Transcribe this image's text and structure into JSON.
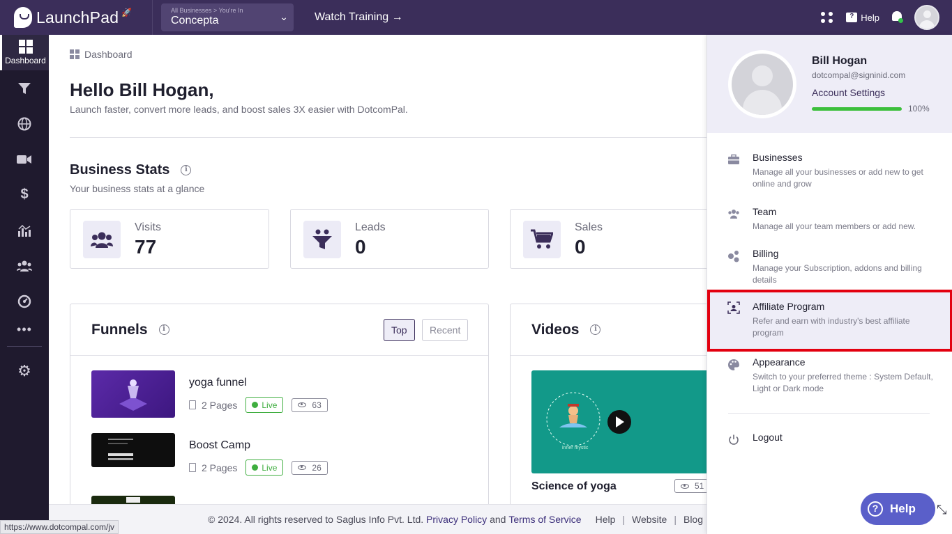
{
  "topbar": {
    "brand": "LaunchPad",
    "business_path": "All Businesses > You're In",
    "business_name": "Concepta",
    "watch_training": "Watch Training →",
    "help": "Help"
  },
  "sidebar": {
    "active_label": "Dashboard"
  },
  "main": {
    "breadcrumb": "Dashboard",
    "hello": "Hello Bill Hogan,",
    "subtitle": "Launch faster, convert more leads, and boost sales 3X easier with DotcomPal.",
    "stats_title": "Business Stats",
    "stats_sub": "Your business stats at a glance",
    "stats": [
      {
        "label": "Visits",
        "value": "77"
      },
      {
        "label": "Leads",
        "value": "0"
      },
      {
        "label": "Sales",
        "value": "0"
      }
    ],
    "funnels": {
      "title": "Funnels",
      "tab_top": "Top",
      "tab_recent": "Recent",
      "items": [
        {
          "name": "yoga funnel",
          "pages": "2 Pages",
          "status": "Live",
          "views": "63"
        },
        {
          "name": "Boost Camp",
          "pages": "2 Pages",
          "status": "Live",
          "views": "26"
        }
      ]
    },
    "videos": {
      "title": "Videos",
      "item_title": "Science of yoga",
      "item_views": "51",
      "thumb_caption": "inner mystic"
    }
  },
  "footer": {
    "copyright": "© 2024. All rights reserved to Saglus Info Pvt. Ltd.",
    "privacy": "Privacy Policy",
    "and": "and",
    "terms": "Terms of Service",
    "help": "Help",
    "website": "Website",
    "blog": "Blog"
  },
  "status_url": "https://www.dotcompal.com/jv",
  "account_menu": {
    "name": "Bill Hogan",
    "email": "dotcompal@signinid.com",
    "settings": "Account Settings",
    "progress_pct": 100,
    "progress_text": "100%",
    "items": [
      {
        "title": "Businesses",
        "desc": "Manage all your businesses or add new to get online and grow"
      },
      {
        "title": "Team",
        "desc": "Manage all your team members or add new."
      },
      {
        "title": "Billing",
        "desc": "Manage your Subscription, addons and billing details"
      },
      {
        "title": "Affiliate Program",
        "desc": "Refer and earn with industry's best affiliate program"
      },
      {
        "title": "Appearance",
        "desc": "Switch to your preferred theme : System Default, Light or Dark mode"
      }
    ],
    "logout": "Logout"
  },
  "help_button": "Help",
  "colors": {
    "accent": "#3b2e5a",
    "live": "#3fae3f",
    "highlight": "#e3000f",
    "help": "#5a5fc9"
  }
}
